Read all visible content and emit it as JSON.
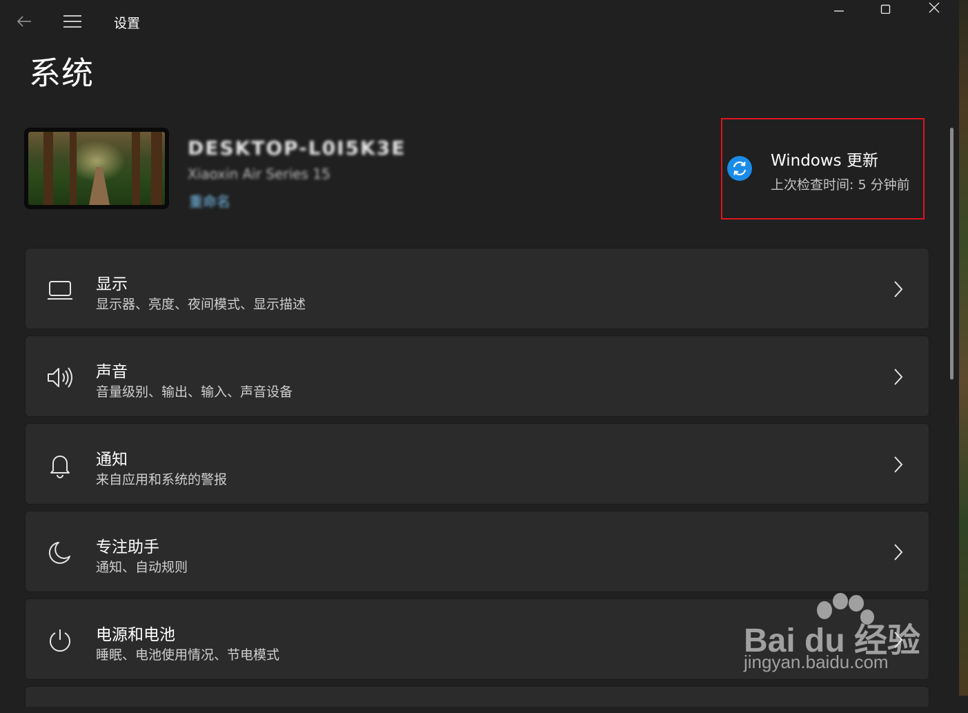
{
  "titlebar": {
    "app_title": "设置",
    "back_icon": "back-arrow-icon",
    "menu_icon": "hamburger-menu-icon",
    "window_controls": [
      "minimize-icon",
      "maximize-icon",
      "close-icon"
    ]
  },
  "page": {
    "title": "系统"
  },
  "device": {
    "name": "DESKTOP-L0I5K3E",
    "model": "Xiaoxin Air Series 15",
    "rename_link": "重命名"
  },
  "update": {
    "title": "Windows 更新",
    "last_checked": "上次检查时间: 5 分钟前",
    "icon": "sync-icon",
    "icon_color": "#1a8ce8",
    "highlight_color": "#e0141e"
  },
  "settings": {
    "items": [
      {
        "label": "显示",
        "description": "显示器、亮度、夜间模式、显示描述",
        "icon": "monitor-icon"
      },
      {
        "label": "声音",
        "description": "音量级别、输出、输入、声音设备",
        "icon": "speaker-icon"
      },
      {
        "label": "通知",
        "description": "来自应用和系统的警报",
        "icon": "bell-icon"
      },
      {
        "label": "专注助手",
        "description": "通知、自动规则",
        "icon": "moon-icon"
      },
      {
        "label": "电源和电池",
        "description": "睡眠、电池使用情况、节电模式",
        "icon": "power-icon"
      }
    ]
  },
  "watermark": {
    "brand": "Bai du 经验",
    "url": "jingyan.baidu.com"
  },
  "colors": {
    "background": "#202020",
    "card": "#2b2b2b",
    "accent": "#1a8ce8"
  }
}
